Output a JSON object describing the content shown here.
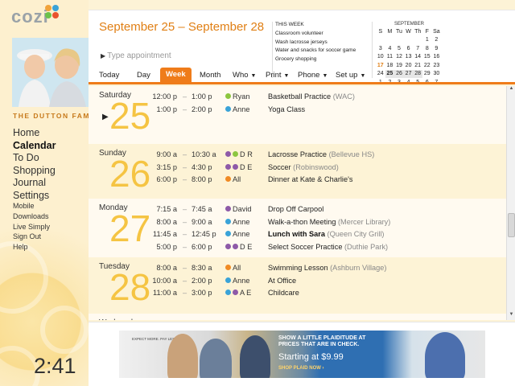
{
  "app": {
    "logo": "cozi",
    "logo_colors": [
      "#f1a33b",
      "#6cc24a",
      "#3aa3d8",
      "#e8532e"
    ]
  },
  "sidebar": {
    "family_name": "THE DUTTON FAM",
    "nav_main": [
      "Home",
      "Calendar",
      "To Do",
      "Shopping",
      "Journal",
      "Settings"
    ],
    "nav_active": "Calendar",
    "nav_sub": [
      "Mobile",
      "Downloads",
      "Live Simply",
      "Sign Out",
      "Help"
    ],
    "clock": "2:41"
  },
  "header": {
    "date_range": "September 25 – September 28",
    "type_appointment_placeholder": "Type appointment",
    "this_week": {
      "title": "THIS WEEK",
      "items": [
        "Classroom volunteer",
        "Wash lacrosse jerseys",
        "Water and snacks for soccer game",
        "Grocery shopping"
      ]
    },
    "mini_calendar": {
      "month": "SEPTEMBER",
      "weekdays": [
        "S",
        "M",
        "Tu",
        "W",
        "Th",
        "F",
        "Sa"
      ],
      "rows": [
        [
          "",
          "",
          "",
          "",
          "",
          "1",
          "2"
        ],
        [
          "3",
          "4",
          "5",
          "6",
          "7",
          "8",
          "9"
        ],
        [
          "10",
          "11",
          "12",
          "13",
          "14",
          "15",
          "16"
        ],
        [
          "17",
          "18",
          "19",
          "20",
          "21",
          "22",
          "23"
        ],
        [
          "24",
          "25",
          "26",
          "27",
          "28",
          "29",
          "30"
        ],
        [
          "1",
          "2",
          "3",
          "4",
          "5",
          "6",
          "7"
        ]
      ],
      "today": "17"
    },
    "tabs": [
      {
        "label": "Today",
        "dropdown": false
      },
      {
        "label": "Day",
        "dropdown": false
      },
      {
        "label": "Week",
        "dropdown": false,
        "active": true
      },
      {
        "label": "Month",
        "dropdown": false
      },
      {
        "label": "Who",
        "dropdown": true
      },
      {
        "label": "Print",
        "dropdown": true
      },
      {
        "label": "Phone",
        "dropdown": true
      },
      {
        "label": "Set up",
        "dropdown": true
      }
    ]
  },
  "people_colors": {
    "Ryan": "#8cc63f",
    "Anne": "#3aa3d8",
    "David": "#8e5aa8",
    "All": "#f08a24",
    "E": "#8e5aa8",
    "R": "#8cc63f",
    "D": "#8e5aa8",
    "A": "#3aa3d8"
  },
  "days": [
    {
      "name": "Saturday",
      "num": "25",
      "current": true,
      "events": [
        {
          "start": "12:00 p",
          "end": "1:00 p",
          "who": [
            "Ryan"
          ],
          "who_label": "Ryan",
          "title": "Basketball Practice",
          "location": "(WAC)"
        },
        {
          "start": "1:00 p",
          "end": "2:00 p",
          "who": [
            "Anne"
          ],
          "who_label": "Anne",
          "title": "Yoga Class",
          "location": ""
        }
      ]
    },
    {
      "name": "Sunday",
      "num": "26",
      "events": [
        {
          "start": "9:00 a",
          "end": "10:30 a",
          "who": [
            "D",
            "D",
            "R"
          ],
          "who_label": "D  R",
          "title": "Lacrosse Practice",
          "location": "(Bellevue HS)"
        },
        {
          "start": "3:15 p",
          "end": "4:30 p",
          "who": [
            "D",
            "E",
            "E"
          ],
          "who_label": "D  E",
          "title": "Soccer",
          "location": "(Robinswood)"
        },
        {
          "start": "6:00 p",
          "end": "8:00 p",
          "who": [
            "All"
          ],
          "who_label": "All",
          "title": "Dinner at Kate & Charlie's",
          "location": ""
        }
      ]
    },
    {
      "name": "Monday",
      "num": "27",
      "events": [
        {
          "start": "7:15 a",
          "end": "7:45 a",
          "who": [
            "David"
          ],
          "who_label": "David",
          "title": "Drop Off Carpool",
          "location": ""
        },
        {
          "start": "8:00 a",
          "end": "9:00 a",
          "who": [
            "Anne"
          ],
          "who_label": "Anne",
          "title": "Walk-a-thon Meeting",
          "location": "(Mercer Library)"
        },
        {
          "start": "11:45 a",
          "end": "12:45 p",
          "who": [
            "Anne"
          ],
          "who_label": "Anne",
          "title": "Lunch with Sara",
          "location": "(Queen City Grill)",
          "bold": true
        },
        {
          "start": "5:00 p",
          "end": "6:00 p",
          "who": [
            "D",
            "E",
            "E"
          ],
          "who_label": "D  E",
          "title": "Select Soccer Practice",
          "location": "(Duthie Park)"
        }
      ]
    },
    {
      "name": "Tuesday",
      "num": "28",
      "events": [
        {
          "start": "8:00 a",
          "end": "8:30 a",
          "who": [
            "All"
          ],
          "who_label": "All",
          "title": "Swimming Lesson",
          "location": "(Ashburn Village)"
        },
        {
          "start": "10:00 a",
          "end": "2:00 p",
          "who": [
            "Anne"
          ],
          "who_label": "Anne",
          "title": "At Office",
          "location": ""
        },
        {
          "start": "11:00 a",
          "end": "3:00 p",
          "who": [
            "A",
            "A",
            "E"
          ],
          "who_label": "A  E",
          "title": "Childcare",
          "location": ""
        }
      ]
    },
    {
      "name": "Wednesday",
      "num": "",
      "events": []
    }
  ],
  "ad": {
    "tagline": "EXPECT MORE. PAY LESS.",
    "promo": "SHOW A LITTLE PLAIDITUDE AT PRICES THAT ARE IN CHECK.",
    "price": "Starting at $9.99",
    "cta": "SHOP PLAID NOW ›"
  }
}
